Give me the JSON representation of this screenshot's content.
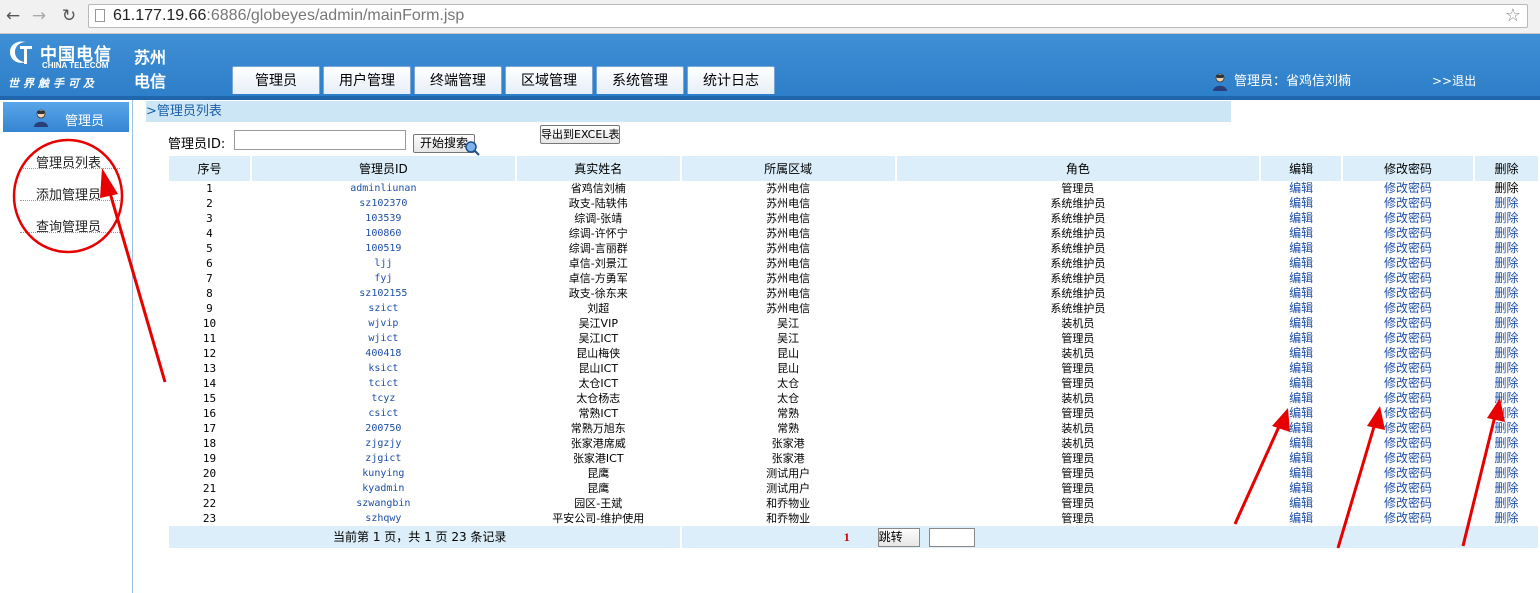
{
  "browser": {
    "url_host": "61.177.19.66",
    "url_rest": ":6886/globeyes/admin/mainForm.jsp"
  },
  "header": {
    "logo_cn": "中国电信",
    "logo_en": "CHINA TELECOM",
    "logo_slogan": "世界触手可及",
    "logo_city_1": "苏州",
    "logo_city_2": "电信",
    "tabs": [
      {
        "label": "管理员"
      },
      {
        "label": "用户管理"
      },
      {
        "label": "终端管理"
      },
      {
        "label": "区域管理"
      },
      {
        "label": "系统管理"
      },
      {
        "label": "统计日志"
      }
    ],
    "user_text": "管理员：省鸡信刘楠",
    "logout": ">>退出"
  },
  "sidebar": {
    "title": "管理员",
    "items": [
      {
        "label": "管理员列表"
      },
      {
        "label": "添加管理员"
      },
      {
        "label": "查询管理员"
      }
    ]
  },
  "main": {
    "breadcrumb": ">管理员列表",
    "search_label": "管理员ID:",
    "search_value": "",
    "search_button": "开始搜索",
    "export_button": "导出到EXCEL表"
  },
  "table": {
    "columns": [
      "序号",
      "管理员ID",
      "真实姓名",
      "所属区域",
      "角色",
      "编辑",
      "修改密码",
      "删除"
    ],
    "rows": [
      [
        "1",
        "adminliunan",
        "省鸡信刘楠",
        "苏州电信",
        "管理员",
        "编辑",
        "修改密码",
        "删除"
      ],
      [
        "2",
        "sz102370",
        "政支-陆轶伟",
        "苏州电信",
        "系统维护员",
        "编辑",
        "修改密码",
        "删除"
      ],
      [
        "3",
        "103539",
        "综调-张靖",
        "苏州电信",
        "系统维护员",
        "编辑",
        "修改密码",
        "删除"
      ],
      [
        "4",
        "100860",
        "综调-许怀宁",
        "苏州电信",
        "系统维护员",
        "编辑",
        "修改密码",
        "删除"
      ],
      [
        "5",
        "100519",
        "综调-言丽群",
        "苏州电信",
        "系统维护员",
        "编辑",
        "修改密码",
        "删除"
      ],
      [
        "6",
        "ljj",
        "卓信-刘景江",
        "苏州电信",
        "系统维护员",
        "编辑",
        "修改密码",
        "删除"
      ],
      [
        "7",
        "fyj",
        "卓信-方勇军",
        "苏州电信",
        "系统维护员",
        "编辑",
        "修改密码",
        "删除"
      ],
      [
        "8",
        "sz102155",
        "政支-徐东来",
        "苏州电信",
        "系统维护员",
        "编辑",
        "修改密码",
        "删除"
      ],
      [
        "9",
        "szict",
        "刘超",
        "苏州电信",
        "系统维护员",
        "编辑",
        "修改密码",
        "删除"
      ],
      [
        "10",
        "wjvip",
        "吴江VIP",
        "吴江",
        "装机员",
        "编辑",
        "修改密码",
        "删除"
      ],
      [
        "11",
        "wjict",
        "吴江ICT",
        "吴江",
        "管理员",
        "编辑",
        "修改密码",
        "删除"
      ],
      [
        "12",
        "400418",
        "昆山梅侠",
        "昆山",
        "装机员",
        "编辑",
        "修改密码",
        "删除"
      ],
      [
        "13",
        "ksict",
        "昆山ICT",
        "昆山",
        "管理员",
        "编辑",
        "修改密码",
        "删除"
      ],
      [
        "14",
        "tcict",
        "太仓ICT",
        "太仓",
        "管理员",
        "编辑",
        "修改密码",
        "删除"
      ],
      [
        "15",
        "tcyz",
        "太仓杨志",
        "太仓",
        "装机员",
        "编辑",
        "修改密码",
        "删除"
      ],
      [
        "16",
        "csict",
        "常熟ICT",
        "常熟",
        "管理员",
        "编辑",
        "修改密码",
        "删除"
      ],
      [
        "17",
        "200750",
        "常熟万旭东",
        "常熟",
        "装机员",
        "编辑",
        "修改密码",
        "删除"
      ],
      [
        "18",
        "zjgzjy",
        "张家港席威",
        "张家港",
        "装机员",
        "编辑",
        "修改密码",
        "删除"
      ],
      [
        "19",
        "zjgict",
        "张家港ICT",
        "张家港",
        "管理员",
        "编辑",
        "修改密码",
        "删除"
      ],
      [
        "20",
        "kunying",
        "昆鹰",
        "测试用户",
        "管理员",
        "编辑",
        "修改密码",
        "删除"
      ],
      [
        "21",
        "kyadmin",
        "昆鹰",
        "测试用户",
        "管理员",
        "编辑",
        "修改密码",
        "删除"
      ],
      [
        "22",
        "szwangbin",
        "园区-王斌",
        "和乔物业",
        "管理员",
        "编辑",
        "修改密码",
        "删除"
      ],
      [
        "23",
        "szhqwy",
        "平安公司-维护使用",
        "和乔物业",
        "管理员",
        "编辑",
        "修改密码",
        "删除"
      ]
    ],
    "footer_text": "当前第 1 页，共 1 页 23 条记录",
    "page_number": "1",
    "jump_button": "跳转",
    "jump_value": ""
  },
  "colors": {
    "header_blue": "#2e7fc9",
    "table_header_bg": "#dbeef9",
    "link_blue": "#1d4fa8",
    "annotation_red": "#e60000"
  },
  "icons": [
    "back-icon",
    "forward-icon",
    "reload-icon",
    "page-icon",
    "star-icon",
    "china-telecom-logo-icon",
    "user-avatar-icon",
    "search-magnifier-icon"
  ]
}
